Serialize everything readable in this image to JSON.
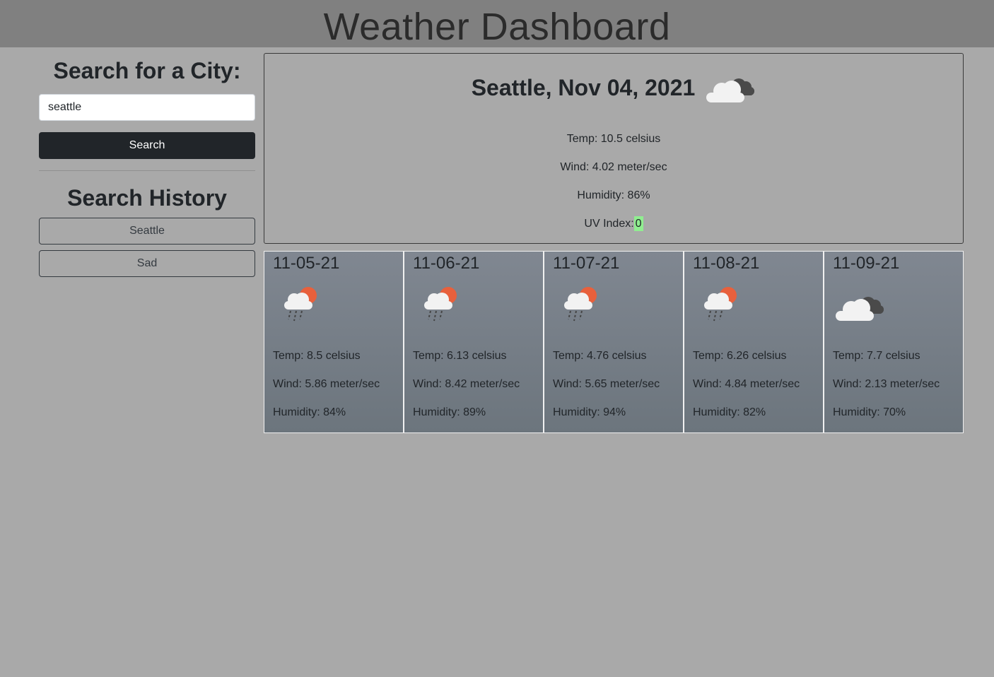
{
  "header": {
    "title": "Weather Dashboard"
  },
  "sidebar": {
    "search_title": "Search for a City:",
    "search_value": "seattle",
    "search_button": "Search",
    "history_title": "Search History",
    "history": [
      "Seattle",
      "Sad"
    ]
  },
  "current": {
    "heading": "Seattle, Nov 04, 2021",
    "icon": "cloudy-icon",
    "temp": "Temp: 10.5 celsius",
    "wind": "Wind: 4.02 meter/sec",
    "humidity": "Humidity: 86%",
    "uv_label": "UV Index:",
    "uv_value": "0",
    "uv_color": "#90ee90"
  },
  "forecast": [
    {
      "date": "11-05-21",
      "icon": "rain-sun-icon",
      "temp": "Temp: 8.5 celsius",
      "wind": "Wind: 5.86 meter/sec",
      "humidity": "Humidity: 84%"
    },
    {
      "date": "11-06-21",
      "icon": "rain-sun-icon",
      "temp": "Temp: 6.13 celsius",
      "wind": "Wind: 8.42 meter/sec",
      "humidity": "Humidity: 89%"
    },
    {
      "date": "11-07-21",
      "icon": "rain-sun-icon",
      "temp": "Temp: 4.76 celsius",
      "wind": "Wind: 5.65 meter/sec",
      "humidity": "Humidity: 94%"
    },
    {
      "date": "11-08-21",
      "icon": "rain-sun-icon",
      "temp": "Temp: 6.26 celsius",
      "wind": "Wind: 4.84 meter/sec",
      "humidity": "Humidity: 82%"
    },
    {
      "date": "11-09-21",
      "icon": "cloudy-icon",
      "temp": "Temp: 7.7 celsius",
      "wind": "Wind: 2.13 meter/sec",
      "humidity": "Humidity: 70%"
    }
  ]
}
